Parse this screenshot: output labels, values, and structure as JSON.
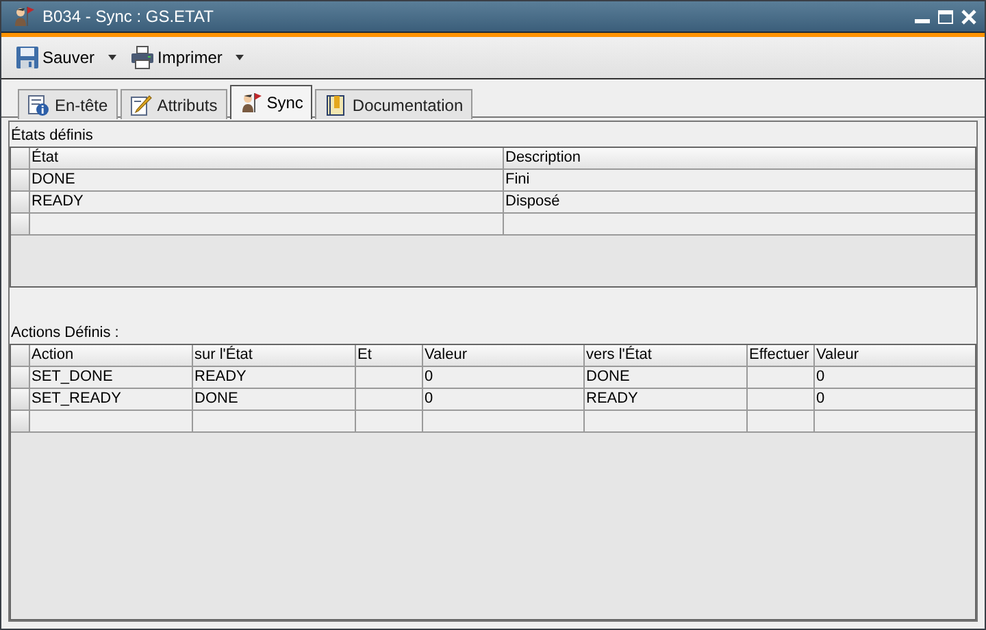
{
  "window": {
    "title": "B034 - Sync : GS.ETAT"
  },
  "toolbar": [
    {
      "label": "Sauver",
      "kind": "save"
    },
    {
      "label": "Imprimer",
      "kind": "print"
    }
  ],
  "tabs": [
    {
      "label": "En-tête",
      "kind": "header",
      "selected": false
    },
    {
      "label": "Attributs",
      "kind": "attributes",
      "selected": false
    },
    {
      "label": "Sync",
      "kind": "sync",
      "selected": true
    },
    {
      "label": "Documentation",
      "kind": "doc",
      "selected": false
    }
  ],
  "states": {
    "title": "États définis",
    "columns": [
      "État",
      "Description"
    ],
    "rows": [
      [
        "DONE",
        "Fini"
      ],
      [
        "READY",
        "Disposé"
      ]
    ]
  },
  "actions": {
    "title": "Actions Définis :",
    "columns": [
      "Action",
      "sur l'État",
      "Et",
      "Valeur",
      "vers l'État",
      "Effectuer",
      "Valeur"
    ],
    "rows": [
      [
        "SET_DONE",
        "READY",
        "",
        "0",
        "DONE",
        "",
        "0"
      ],
      [
        "SET_READY",
        "DONE",
        "",
        "0",
        "READY",
        "",
        "0"
      ]
    ]
  }
}
